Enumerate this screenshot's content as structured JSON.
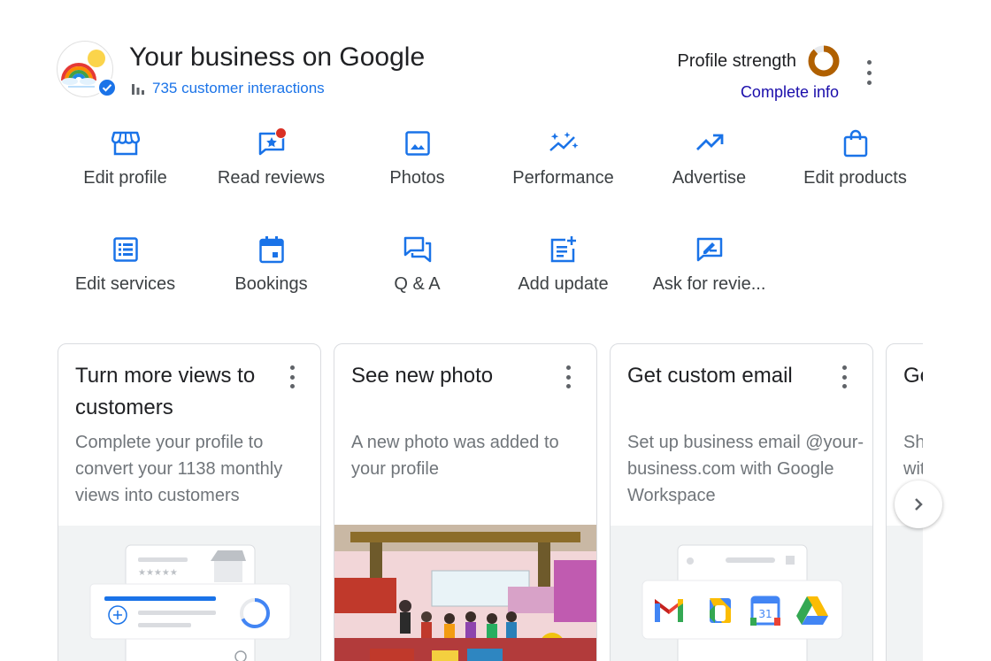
{
  "header": {
    "title": "Your business on Google",
    "interactions": "735 customer interactions",
    "profile_strength_label": "Profile strength",
    "complete_info": "Complete info"
  },
  "actions": [
    {
      "label": "Edit profile",
      "icon": "storefront-icon"
    },
    {
      "label": "Read reviews",
      "icon": "review-star-icon",
      "badge": true
    },
    {
      "label": "Photos",
      "icon": "image-icon"
    },
    {
      "label": "Performance",
      "icon": "sparkle-trend-icon"
    },
    {
      "label": "Advertise",
      "icon": "trending-up-icon"
    },
    {
      "label": "Edit products",
      "icon": "shopping-bag-icon"
    },
    {
      "label": "Edit services",
      "icon": "list-icon"
    },
    {
      "label": "Bookings",
      "icon": "calendar-icon"
    },
    {
      "label": "Q & A",
      "icon": "forum-icon"
    },
    {
      "label": "Add update",
      "icon": "post-add-icon"
    },
    {
      "label": "Ask for revie...",
      "icon": "rate-review-icon"
    }
  ],
  "cards": [
    {
      "title": "Turn more views to customers",
      "desc": "Complete your profile to convert your 1138 monthly views into customers"
    },
    {
      "title": "See new photo",
      "desc": "A new photo was added to your profile"
    },
    {
      "title": "Get custom email",
      "desc": "Set up business email @your-business.com with Google Workspace"
    },
    {
      "title": "Ge",
      "desc": "Sh wit"
    }
  ],
  "calendar_day": "31",
  "colors": {
    "accent": "#1a73e8",
    "link": "#1a0dab",
    "badge": "#d93025",
    "strength_ring": "#b06000"
  }
}
